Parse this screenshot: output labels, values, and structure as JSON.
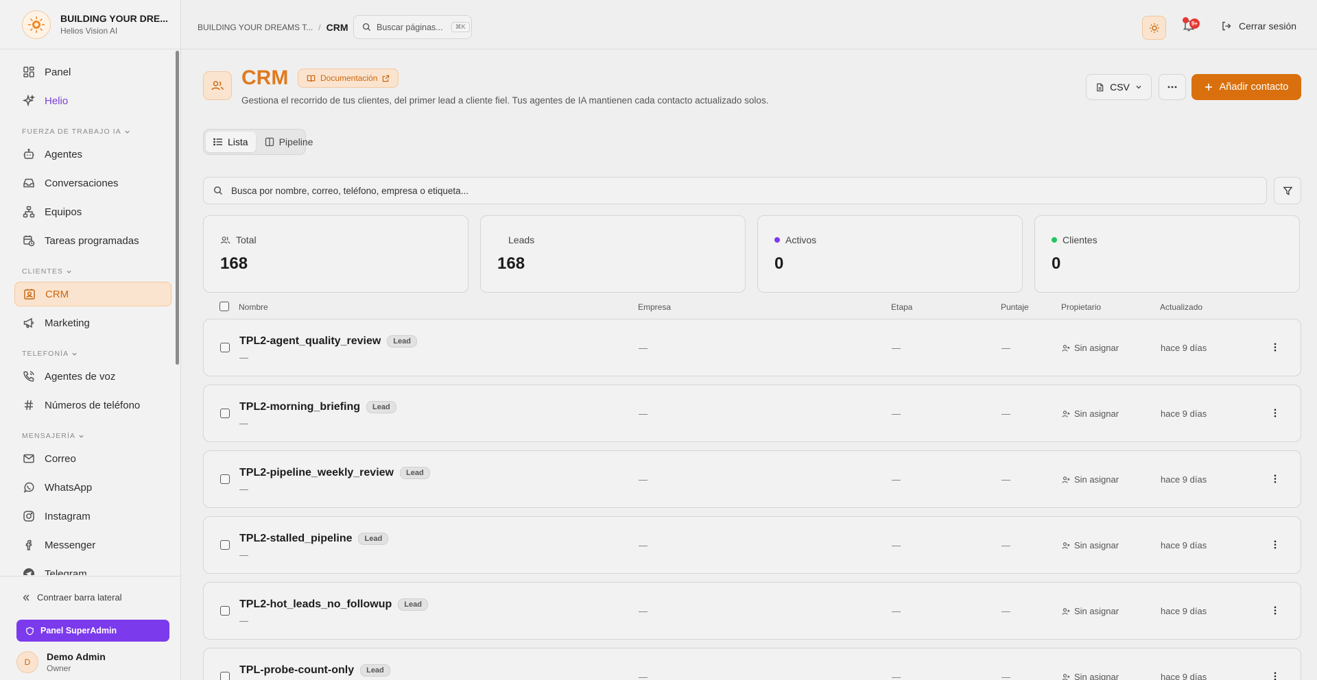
{
  "brand": {
    "title": "BUILDING YOUR DRE...",
    "subtitle": "Helios Vision AI"
  },
  "sidebar": {
    "top_items": [
      {
        "label": "Panel",
        "icon": "grid-icon"
      },
      {
        "label": "Helio",
        "icon": "sparkles-icon"
      }
    ],
    "sections": [
      {
        "label": "FUERZA DE TRABAJO IA",
        "items": [
          "Agentes",
          "Conversaciones",
          "Equipos",
          "Tareas programadas"
        ]
      },
      {
        "label": "CLIENTES",
        "items": [
          "CRM",
          "Marketing"
        ]
      },
      {
        "label": "TELEFONÍA",
        "items": [
          "Agentes de voz",
          "Números de teléfono"
        ]
      },
      {
        "label": "MENSAJERÍA",
        "items": [
          "Correo",
          "WhatsApp",
          "Instagram",
          "Messenger",
          "Telegram"
        ]
      }
    ],
    "active_item": "CRM",
    "collapse_label": "Contraer barra lateral",
    "superadmin_label": "Panel SuperAdmin",
    "user": {
      "initial": "D",
      "name": "Demo Admin",
      "role": "Owner"
    }
  },
  "topbar": {
    "breadcrumb_parent": "BUILDING YOUR DREAMS T...",
    "breadcrumb_sep": "/",
    "breadcrumb_current": "CRM",
    "search_placeholder": "Buscar páginas...",
    "search_shortcut": "⌘K",
    "notifications_badge": "9+",
    "logout_label": "Cerrar sesión"
  },
  "page": {
    "title": "CRM",
    "doc_label": "Documentación",
    "subtitle": "Gestiona el recorrido de tus clientes, del primer lead a cliente fiel. Tus agentes de IA mantienen cada contacto actualizado solos.",
    "csv_label": "CSV",
    "add_label": "Añadir contacto",
    "tabs": [
      {
        "label": "Lista"
      },
      {
        "label": "Pipeline"
      }
    ],
    "search_placeholder": "Busca por nombre, correo, teléfono, empresa o etiqueta..."
  },
  "stats": [
    {
      "label": "Total",
      "value": "168",
      "icon": "users-icon"
    },
    {
      "label": "Leads",
      "value": "168"
    },
    {
      "label": "Activos",
      "value": "0",
      "dot_color": "#7c3aed"
    },
    {
      "label": "Clientes",
      "value": "0",
      "dot_color": "#22c55e"
    }
  ],
  "table": {
    "columns": [
      "Nombre",
      "Empresa",
      "Etapa",
      "Puntaje",
      "Propietario",
      "Actualizado"
    ],
    "rows": [
      {
        "name": "TPL2-agent_quality_review",
        "badge": "Lead",
        "sub": "—",
        "company": "—",
        "stage": "—",
        "score": "—",
        "owner": "Sin asignar",
        "updated": "hace 9 días"
      },
      {
        "name": "TPL2-morning_briefing",
        "badge": "Lead",
        "sub": "—",
        "company": "—",
        "stage": "—",
        "score": "—",
        "owner": "Sin asignar",
        "updated": "hace 9 días"
      },
      {
        "name": "TPL2-pipeline_weekly_review",
        "badge": "Lead",
        "sub": "—",
        "company": "—",
        "stage": "—",
        "score": "—",
        "owner": "Sin asignar",
        "updated": "hace 9 días"
      },
      {
        "name": "TPL2-stalled_pipeline",
        "badge": "Lead",
        "sub": "—",
        "company": "—",
        "stage": "—",
        "score": "—",
        "owner": "Sin asignar",
        "updated": "hace 9 días"
      },
      {
        "name": "TPL2-hot_leads_no_followup",
        "badge": "Lead",
        "sub": "—",
        "company": "—",
        "stage": "—",
        "score": "—",
        "owner": "Sin asignar",
        "updated": "hace 9 días"
      },
      {
        "name": "TPL-probe-count-only",
        "badge": "Lead",
        "sub": "—",
        "company": "—",
        "stage": "—",
        "score": "—",
        "owner": "Sin asignar",
        "updated": "hace 9 días"
      }
    ]
  },
  "colors": {
    "accent": "#d9700d",
    "accent_soft": "#fbe4cf",
    "helio": "#7a3fd8",
    "superadmin": "#7c3aed",
    "notification": "#e53935"
  }
}
